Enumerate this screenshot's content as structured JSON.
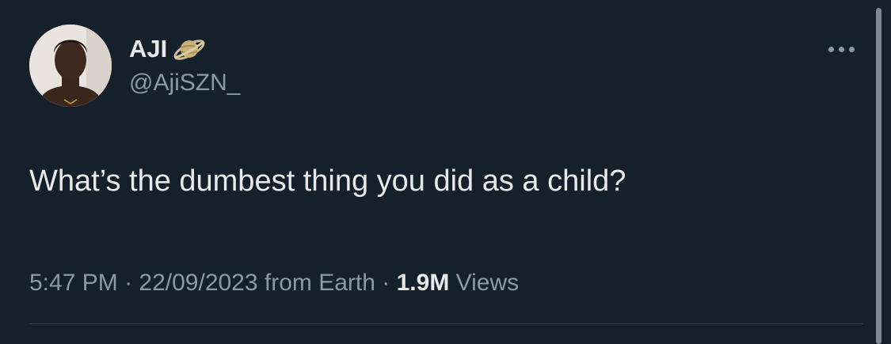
{
  "tweet": {
    "author": {
      "display_name": "AJI",
      "handle": "@AjiSZN_",
      "badge_icon": "saturn-planet-emoji"
    },
    "text": "What’s the dumbest thing you did as a child?",
    "meta": {
      "time": "5:47 PM",
      "separator": " · ",
      "date": "22/09/2023",
      "source": "from Earth",
      "views_count": "1.9M",
      "views_label": "Views"
    }
  },
  "theme": {
    "background": "#15202b",
    "primary_text": "#e7e9ea",
    "secondary_text": "#8b98a5",
    "divider": "#38444d"
  }
}
